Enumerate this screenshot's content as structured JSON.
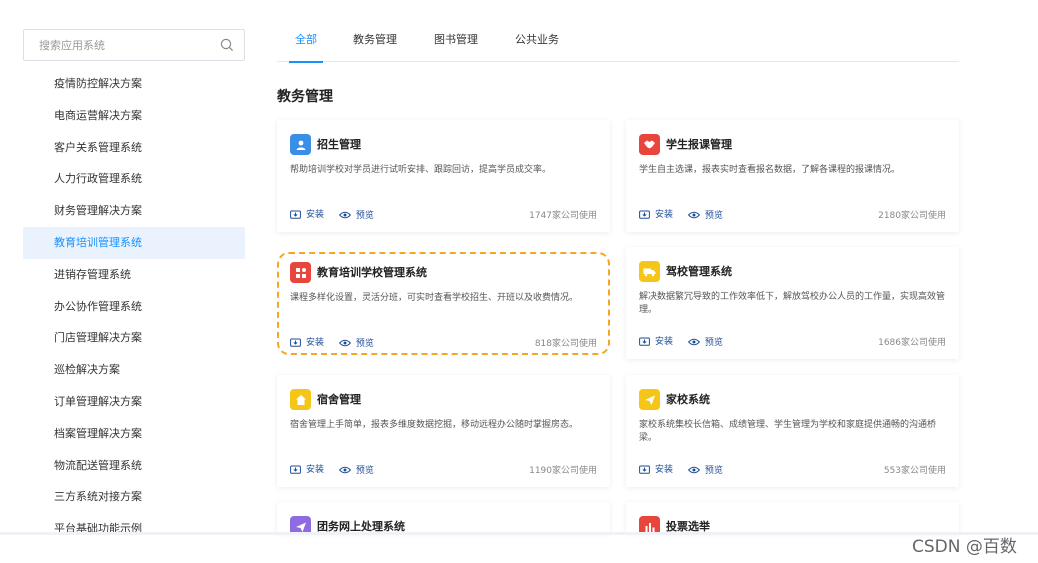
{
  "search": {
    "placeholder": "搜索应用系统",
    "value": ""
  },
  "sidebar": {
    "items": [
      {
        "label": "疫情防控解决方案",
        "active": false
      },
      {
        "label": "电商运营解决方案",
        "active": false
      },
      {
        "label": "客户关系管理系统",
        "active": false
      },
      {
        "label": "人力行政管理系统",
        "active": false
      },
      {
        "label": "财务管理解决方案",
        "active": false
      },
      {
        "label": "教育培训管理系统",
        "active": true
      },
      {
        "label": "进销存管理系统",
        "active": false
      },
      {
        "label": "办公协作管理系统",
        "active": false
      },
      {
        "label": "门店管理解决方案",
        "active": false
      },
      {
        "label": "巡检解决方案",
        "active": false
      },
      {
        "label": "订单管理解决方案",
        "active": false
      },
      {
        "label": "档案管理解决方案",
        "active": false
      },
      {
        "label": "物流配送管理系统",
        "active": false
      },
      {
        "label": "三方系统对接方案",
        "active": false
      },
      {
        "label": "平台基础功能示例",
        "active": false
      }
    ]
  },
  "tabs": [
    {
      "label": "全部",
      "active": true
    },
    {
      "label": "教务管理",
      "active": false
    },
    {
      "label": "图书管理",
      "active": false
    },
    {
      "label": "公共业务",
      "active": false
    }
  ],
  "section_title": "教务管理",
  "actions": {
    "install": "安装",
    "preview": "预览"
  },
  "cards": [
    {
      "title": "招生管理",
      "desc": "帮助培训学校对学员进行试听安排、跟踪回访，提高学员成交率。",
      "usage": "1747家公司使用",
      "icon": "user-icon",
      "color": "#3a8ee6"
    },
    {
      "title": "学生报课管理",
      "desc": "学生自主选课，报表实时查看报名数据，了解各课程的报课情况。",
      "usage": "2180家公司使用",
      "icon": "handshake-icon",
      "color": "#e8453c"
    },
    {
      "title": "教育培训学校管理系统",
      "desc": "课程多样化设置，灵活分班，可实时查看学校招生、开班以及收费情况。",
      "usage": "818家公司使用",
      "icon": "grid-icon",
      "color": "#e8453c"
    },
    {
      "title": "驾校管理系统",
      "desc": "解决数据繁冗导致的工作效率低下，解放驾校办公人员的工作量，实现高效管理。",
      "usage": "1686家公司使用",
      "icon": "truck-icon",
      "color": "#f5c518"
    },
    {
      "title": "宿舍管理",
      "desc": "宿舍管理上手简单，报表多维度数据挖掘，移动远程办公随时掌握房态。",
      "usage": "1190家公司使用",
      "icon": "home-icon",
      "color": "#f5c518"
    },
    {
      "title": "家校系统",
      "desc": "家校系统集校长信箱、成绩管理、学生管理为学校和家庭提供通畅的沟通桥梁。",
      "usage": "553家公司使用",
      "icon": "send-icon",
      "color": "#f5c518"
    },
    {
      "title": "团务网上处理系统",
      "desc": "",
      "usage": "",
      "icon": "send-icon",
      "color": "#8e6be0"
    },
    {
      "title": "投票选举",
      "desc": "",
      "usage": "",
      "icon": "bar-chart-icon",
      "color": "#e8453c"
    }
  ],
  "watermark": "CSDN @百数"
}
